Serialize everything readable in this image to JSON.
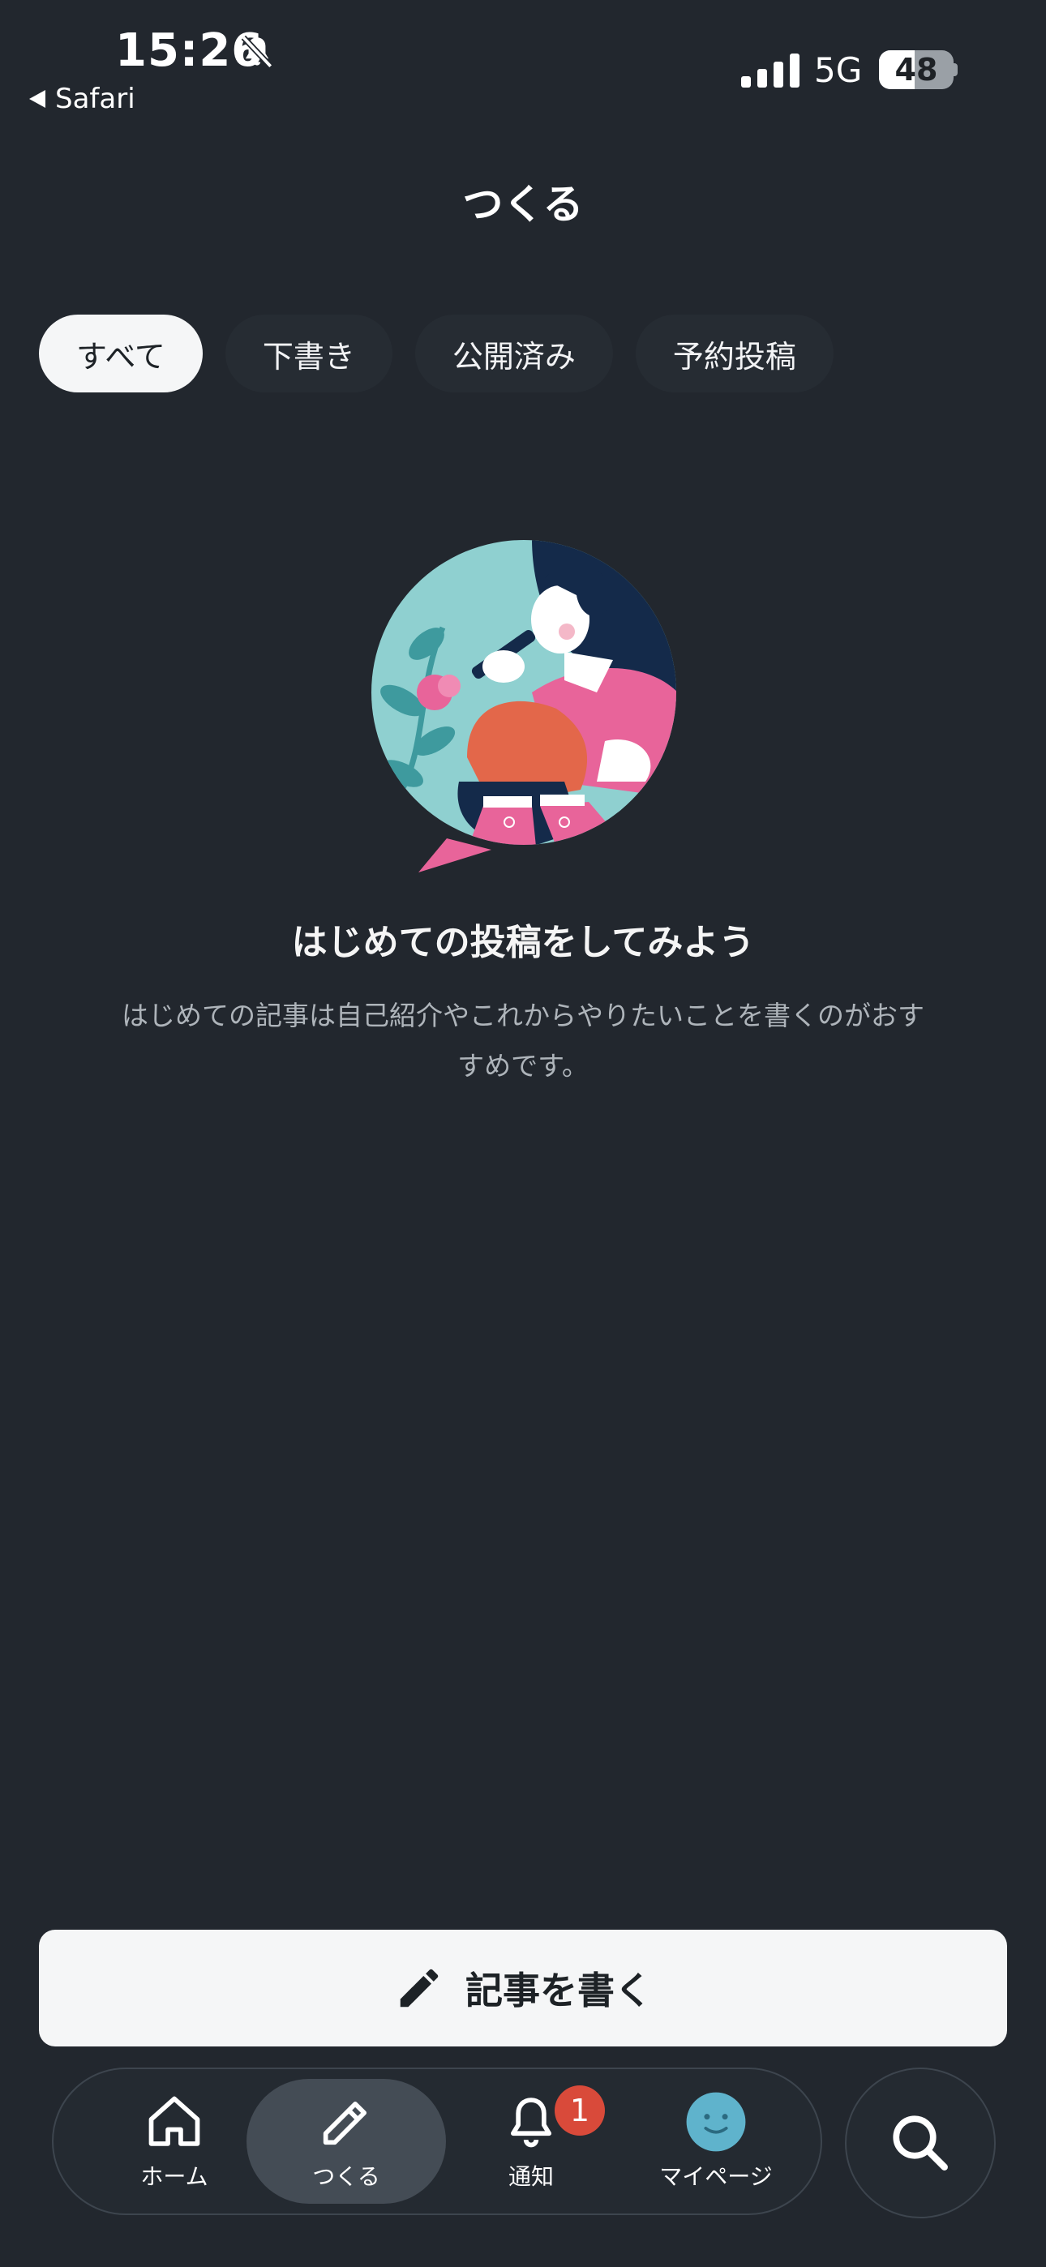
{
  "status_bar": {
    "time": "15:26",
    "back_app": "Safari",
    "network": "5G",
    "battery": "48",
    "battery_level": 0.48,
    "icons": [
      "bell-slash-icon",
      "signal-icon",
      "battery-icon"
    ]
  },
  "header": {
    "title": "つくる"
  },
  "tabs": [
    {
      "label": "すべて",
      "active": true
    },
    {
      "label": "下書き",
      "active": false
    },
    {
      "label": "公開済み",
      "active": false
    },
    {
      "label": "予約投稿",
      "active": false
    }
  ],
  "empty_state": {
    "title": "はじめての投稿をしてみよう",
    "description": "はじめての記事は自己紹介やこれからやりたいことを書くのがおすすめです。"
  },
  "write_button": {
    "label": "記事を書く",
    "icon": "pencil-icon"
  },
  "bottom_nav": {
    "items": [
      {
        "label": "ホーム",
        "icon": "home-icon",
        "active": false
      },
      {
        "label": "つくる",
        "icon": "pencil-icon",
        "active": true
      },
      {
        "label": "通知",
        "icon": "bell-icon",
        "active": false,
        "badge": "1"
      },
      {
        "label": "マイページ",
        "icon": "avatar-icon",
        "active": false
      }
    ],
    "search_icon": "search-icon"
  },
  "colors": {
    "background": "#22272e",
    "active_pill": "#f5f6f7",
    "badge": "#d94a3a",
    "avatar": "#5fb3cc"
  }
}
